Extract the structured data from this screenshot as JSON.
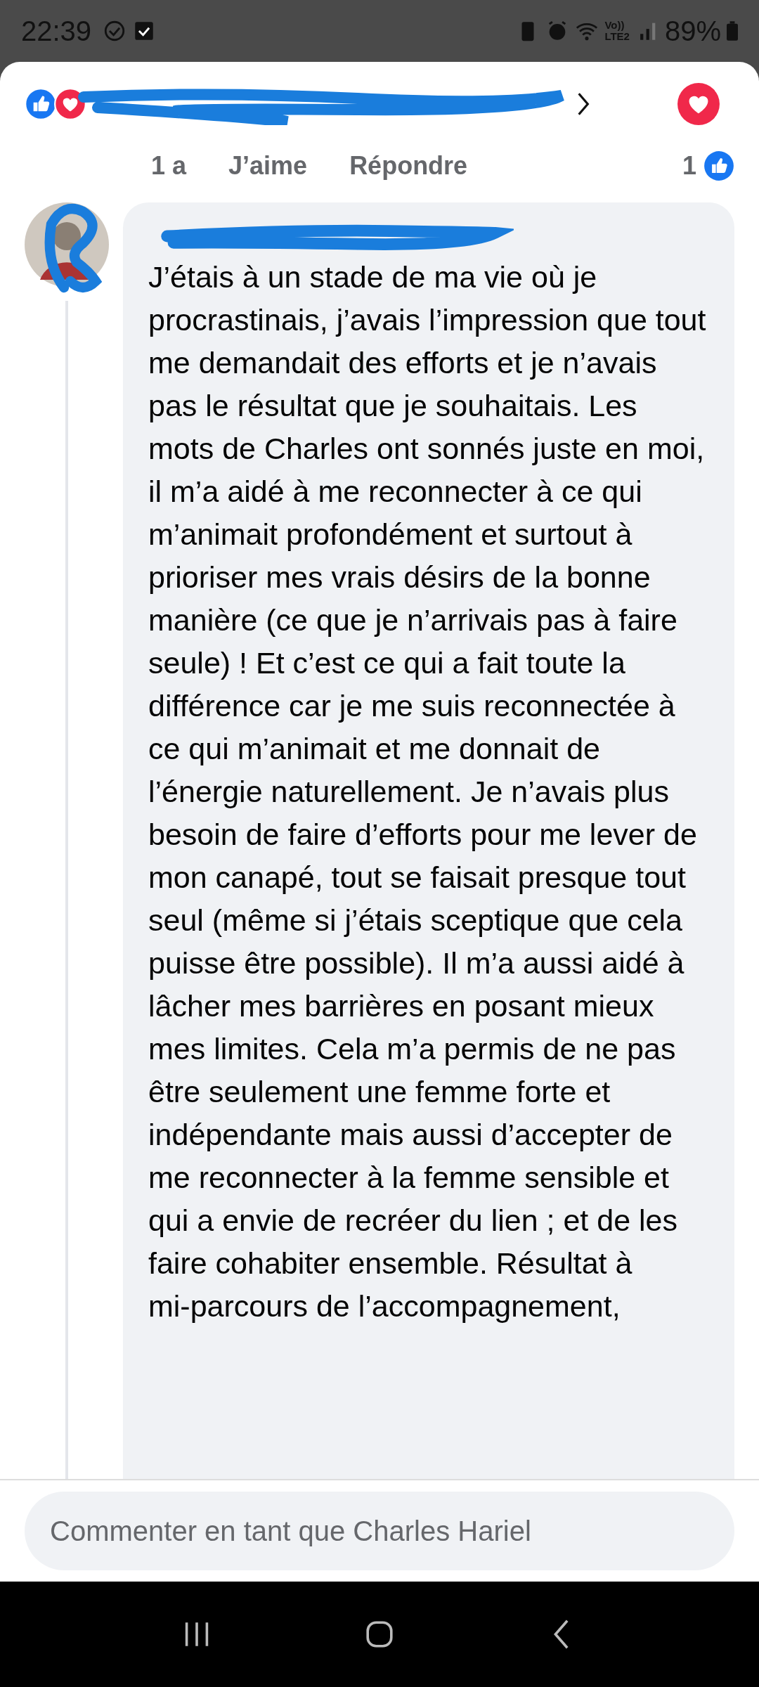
{
  "status_bar": {
    "time": "22:39",
    "network_top": "Vo))",
    "network_bottom": "LTE2",
    "battery": "89%"
  },
  "header": {
    "reactions": [
      {
        "kind": "like"
      },
      {
        "kind": "love"
      }
    ]
  },
  "actions": {
    "time": "1 a",
    "like": "J’aime",
    "reply": "Répondre",
    "count": "1"
  },
  "comment": {
    "text": "J’étais à un stade de ma vie où je procrastinais, j’avais l’impression que tout me demandait des efforts et je n’avais pas le résultat que je souhaitais. Les mots de Charles ont sonnés juste en moi, il m’a aidé à me reconnecter à ce qui m’animait profondément et surtout à prioriser mes vrais désirs de la bonne manière (ce que je n’arrivais pas à faire seule) ! Et c’est ce qui a fait toute la différence car je me suis reconnectée à ce qui m’animait et me donnait de l’énergie naturellement. Je n’avais plus besoin de faire d’efforts pour me lever de mon canapé, tout se faisait presque tout seul (même si j’étais sceptique que cela puisse être possible). Il m’a aussi aidé à lâcher mes barrières en posant mieux mes limites. Cela m’a permis de ne pas être seulement une femme forte et indépendante mais aussi d’accepter de me reconnecter à la femme sensible et qui a envie de recréer du lien ; et de les faire cohabiter ensemble. Résultat à mi‑parcours de l’accompagnement,"
  },
  "composer": {
    "placeholder": "Commenter en tant que Charles Hariel"
  }
}
